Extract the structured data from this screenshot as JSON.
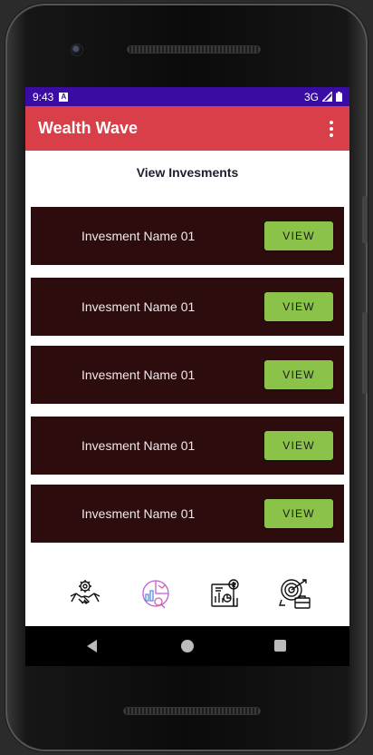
{
  "status_bar": {
    "time": "9:43",
    "network": "3G",
    "notification_icon": "a-icon"
  },
  "app_bar": {
    "title": "Wealth Wave",
    "menu_icon": "more-vert-icon"
  },
  "page": {
    "title": "View Invesments"
  },
  "investments": [
    {
      "name": "Invesment Name 01",
      "button": "VIEW"
    },
    {
      "name": "Invesment Name 01",
      "button": "VIEW"
    },
    {
      "name": "Invesment Name 01",
      "button": "VIEW"
    },
    {
      "name": "Invesment Name 01",
      "button": "VIEW"
    },
    {
      "name": "Invesment Name 01",
      "button": "VIEW"
    }
  ],
  "bottom_nav": [
    {
      "icon": "handshake-gear-icon",
      "active": false
    },
    {
      "icon": "analytics-chart-icon",
      "active": true
    },
    {
      "icon": "report-document-icon",
      "active": false
    },
    {
      "icon": "target-briefcase-icon",
      "active": false
    }
  ],
  "colors": {
    "status_bar": "#3a0ca3",
    "app_bar": "#d83f49",
    "card_background": "#2d0c0d",
    "button": "#8bc34a",
    "active_nav_icon": "#c15bd6"
  }
}
